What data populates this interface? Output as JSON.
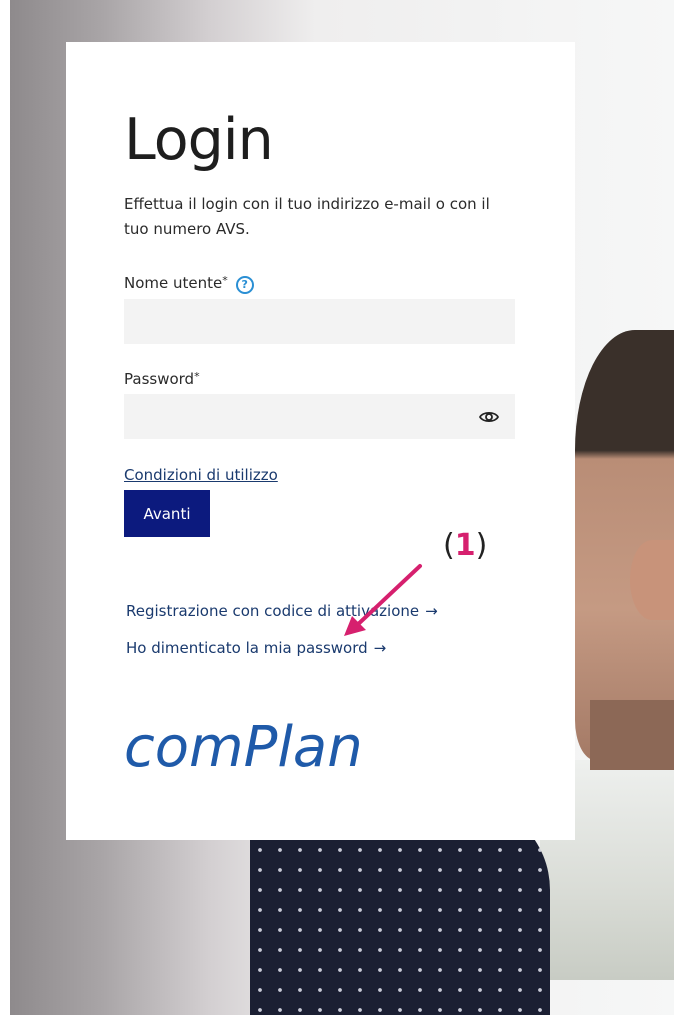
{
  "login": {
    "title": "Login",
    "subtitle": "Effettua il login con il tuo indirizzo e-mail o con il tuo numero AVS.",
    "username_label": "Nome utente",
    "username_value": "",
    "password_label": "Password",
    "password_value": "",
    "required_marker": "*",
    "help_icon": "?",
    "terms_link": "Condizioni di utilizzo",
    "submit_label": "Avanti",
    "register_link": "Registrazione con codice di attivazione",
    "forgot_link": "Ho dimenticato la mia password",
    "link_arrow": "→"
  },
  "brand": {
    "logo_text": "comPlan",
    "logo_color": "#1f5aa9",
    "button_color": "#0c1a7e"
  },
  "annotation": {
    "open_paren": "(",
    "number": "1",
    "close_paren": ")",
    "color": "#d6206e"
  },
  "icons": {
    "help": "help-icon",
    "password_visibility": "eye-icon",
    "annotation_arrow": "arrow-icon"
  }
}
